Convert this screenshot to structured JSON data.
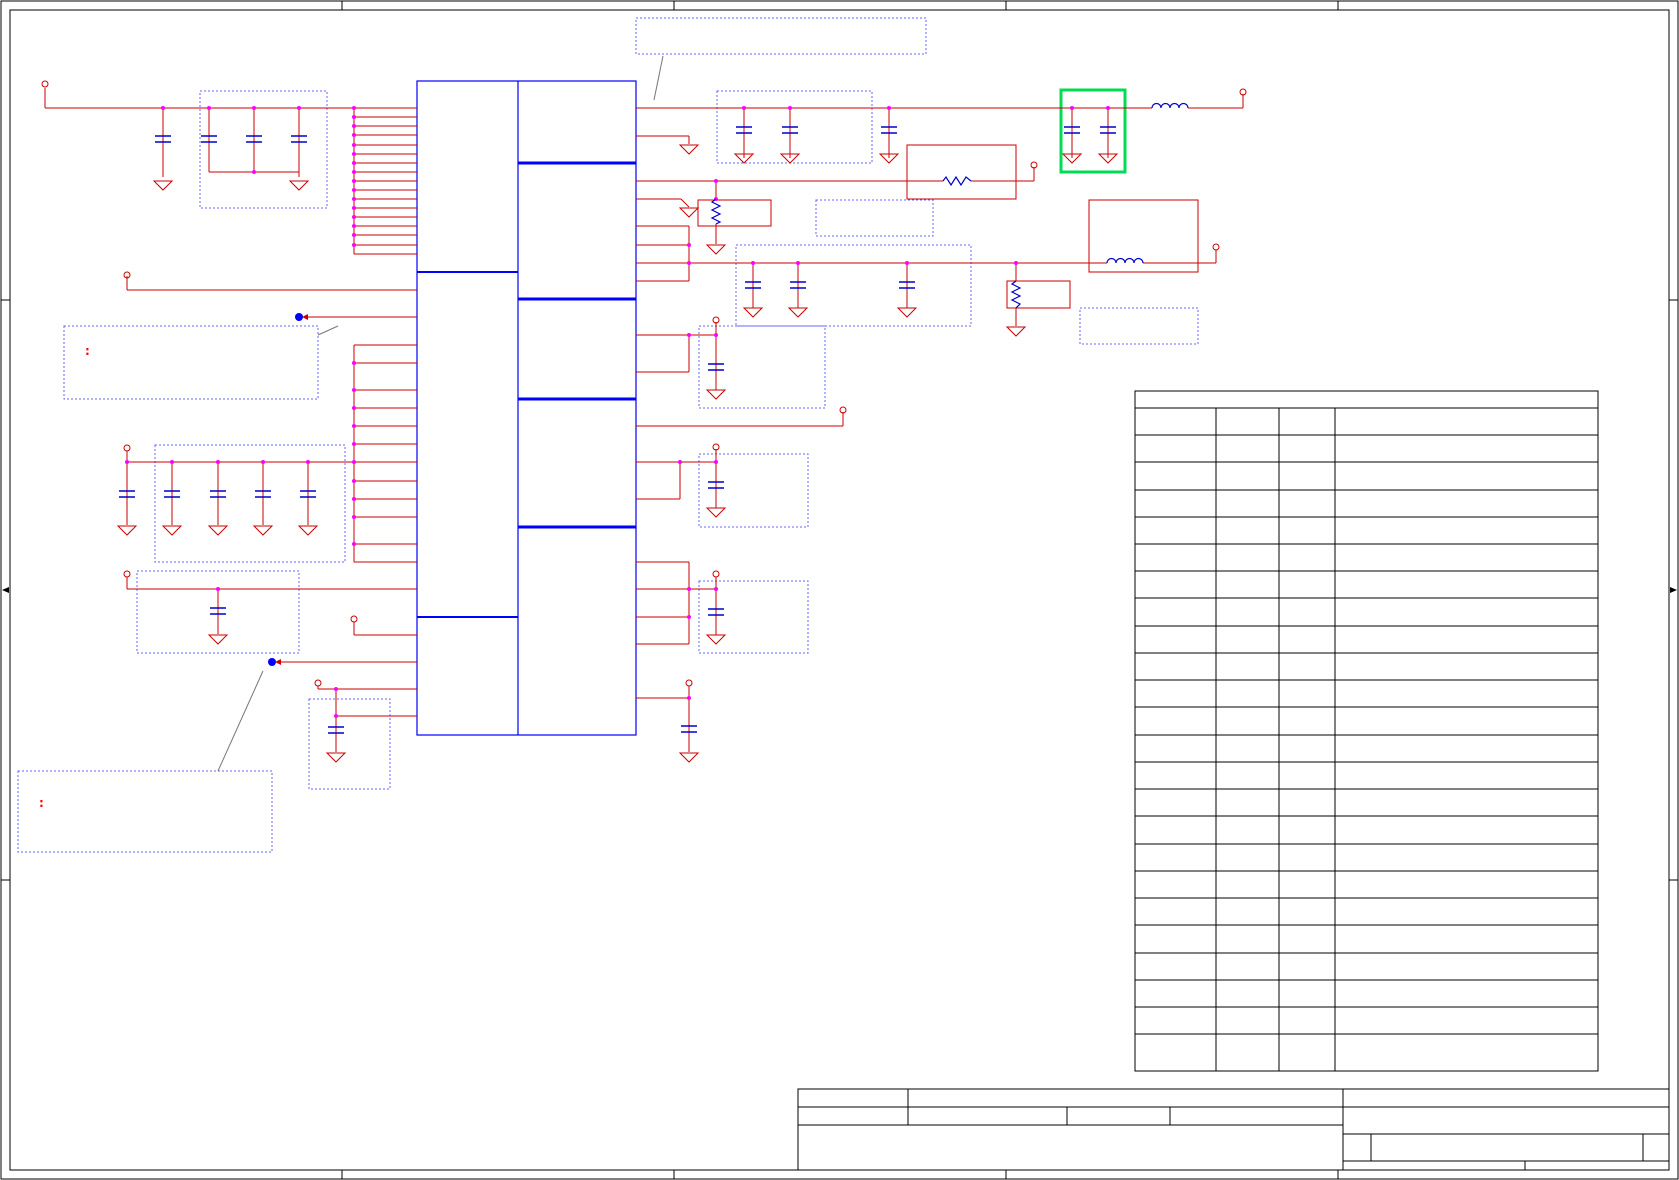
{
  "annotation_markers": [
    ":",
    ":"
  ],
  "colors": {
    "frame": "#000000",
    "wire": "#cc0000",
    "component": "#0000cc",
    "chip_outline": "#0000ff",
    "junction": "#ff00ff",
    "note_box": "#6666ff",
    "highlight": "#00dd55",
    "port_dot": "#0000ff"
  },
  "icons": [
    "capacitor-icon",
    "ground-icon",
    "inductor-icon",
    "resistor-icon",
    "power-port-icon"
  ]
}
